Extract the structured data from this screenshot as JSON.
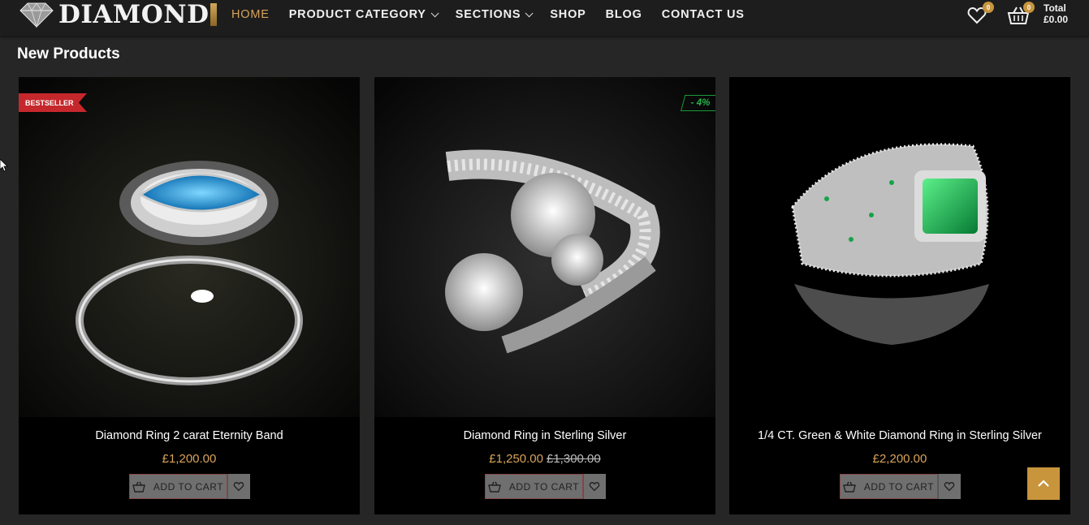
{
  "brand": {
    "name": "DIAMOND"
  },
  "nav": {
    "items": [
      {
        "label": "HOME",
        "active": true
      },
      {
        "label": "PRODUCT CATEGORY",
        "dropdown": true
      },
      {
        "label": "SECTIONS",
        "dropdown": true
      },
      {
        "label": "SHOP"
      },
      {
        "label": "BLOG"
      },
      {
        "label": "CONTACT US"
      }
    ]
  },
  "header": {
    "wishlist_count": "0",
    "cart_count": "0",
    "total_label": "Total",
    "total_value": "£0.00"
  },
  "section": {
    "title": "New Products"
  },
  "products": [
    {
      "name": "Diamond Ring 2 carat Eternity Band",
      "price": "£1,200.00",
      "old_price": "",
      "badge": "BESTSELLER",
      "stone_color": "#1e8fd0",
      "add_to_cart": "ADD TO CART"
    },
    {
      "name": "Diamond Ring in Sterling Silver",
      "price": "£1,250.00",
      "old_price": "£1,300.00",
      "discount": "- 4%",
      "add_to_cart": "ADD TO CART"
    },
    {
      "name": "1/4 CT. Green & White Diamond Ring in Sterling Silver",
      "price": "£2,200.00",
      "old_price": "",
      "stone_color": "#0fae4a",
      "add_to_cart": "ADD TO CART"
    }
  ],
  "colors": {
    "accent": "#c8953d",
    "price": "#d9a35a",
    "badge_red": "#c5282c",
    "discount_green": "#29b24c"
  },
  "icons": [
    "diamond-logo-icon",
    "chevron-down-icon",
    "heart-icon",
    "basket-icon",
    "cart-icon",
    "arrow-up-icon"
  ]
}
